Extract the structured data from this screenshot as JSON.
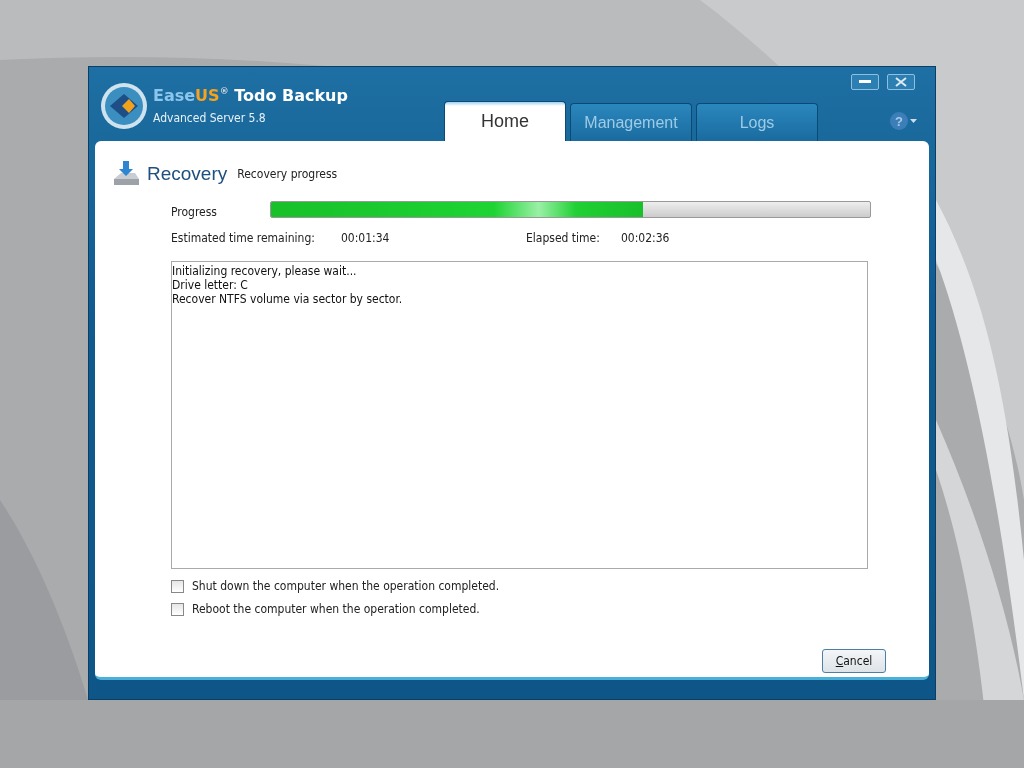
{
  "window": {
    "title_parts": [
      {
        "text": "Ease",
        "kind": "plain"
      },
      {
        "text": "US",
        "kind": "accent"
      },
      {
        "text": "®",
        "kind": "mark"
      },
      {
        "text": " Todo Backup",
        "kind": "product"
      }
    ],
    "subtitle": "Advanced Server 5.8"
  },
  "tabs": [
    {
      "label": "Home",
      "selected": true
    },
    {
      "label": "Management",
      "selected": false
    },
    {
      "label": "Logs",
      "selected": false
    }
  ],
  "help": {
    "label": "?"
  },
  "page": {
    "title": "Recovery",
    "subtitle": "Recovery progress"
  },
  "progress": {
    "label": "Progress",
    "level": 0.62
  },
  "times": [
    {
      "label": "Estimated time remaining:",
      "value": "00:01:34"
    },
    {
      "label": "Elapsed time:",
      "value": "00:02:36"
    }
  ],
  "log": [
    "Initializing recovery, please wait...",
    "Drive letter: C",
    "Recover NTFS volume via sector by sector."
  ],
  "options": [
    {
      "label": "Shut down the computer when the operation completed.",
      "checked": false
    },
    {
      "label": "Reboot the computer when the operation completed.",
      "checked": false
    }
  ],
  "buttons": [
    {
      "label": "Cancel"
    }
  ]
}
